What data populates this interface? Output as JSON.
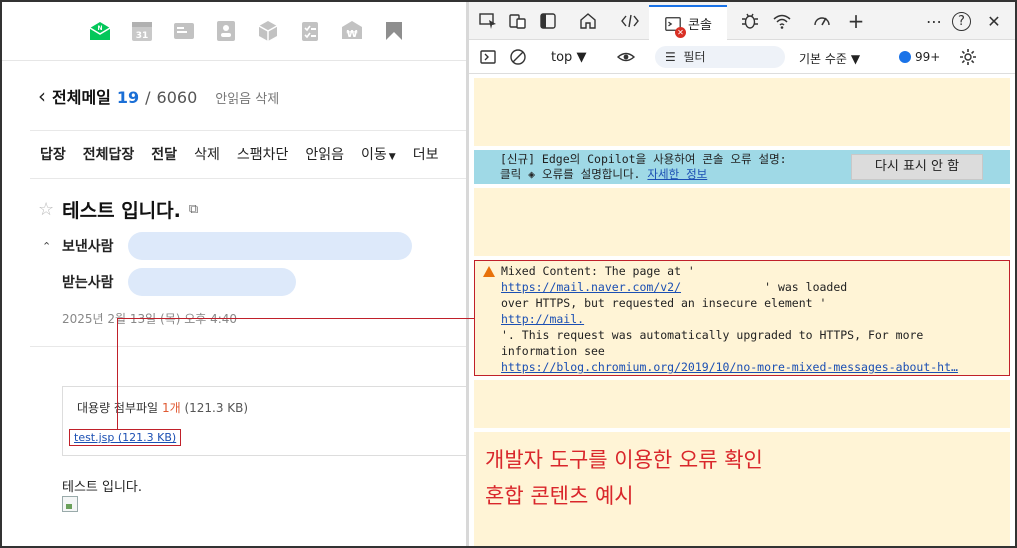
{
  "app_icons": [
    "naver-mail-icon",
    "calendar-icon",
    "contact-card-icon",
    "address-book-icon",
    "box-icon",
    "todo-icon",
    "pay-icon",
    "home-icon",
    "flag-icon"
  ],
  "calendar_number": "31",
  "mailbox": {
    "title": "전체메일",
    "unread": "19",
    "sep": "/",
    "total": "6060",
    "mark_read": "안읽음 삭제"
  },
  "mail_toolbar": {
    "reply": "답장",
    "reply_all": "전체답장",
    "forward": "전달",
    "delete": "삭제",
    "spam": "스팸차단",
    "unread": "안읽음",
    "move": "이동",
    "more": "더보"
  },
  "message": {
    "subject": "테스트 입니다.",
    "sender_label": "보낸사람",
    "receiver_label": "받는사람",
    "date": "2025년 2월 13일 (목) 오후 4:40",
    "attach_label": "대용량 첨부파일",
    "attach_count": "1개",
    "attach_size": "(121.3 KB)",
    "attach_file": "test.jsp (121.3 KB)",
    "body": "테스트 입니다."
  },
  "devtools": {
    "console_tab": "콘솔",
    "add_tab": "+",
    "more": "⋯",
    "help": "?",
    "close": "✕",
    "context": "top",
    "filter_placeholder": "필터",
    "level": "기본 수준",
    "issues_count": "99+",
    "copilot_line1": "[신규] Edge의 Copilot을 사용하여 콘솔 오류 설명:",
    "copilot_line2": "클릭",
    "copilot_line2b": "오류를 설명합니다.",
    "copilot_link": "자세한 정보",
    "dismiss": "다시 표시 안 함",
    "warn_line1": "Mixed Content: The page at '",
    "warn_url1": "https://mail.naver.com/v2/",
    "warn_line2b": "' was loaded",
    "warn_line3": "over HTTPS, but requested an insecure element '",
    "warn_url2": "http://mail.",
    "warn_line5": "'. This request was automatically upgraded to HTTPS, For more",
    "warn_line6": "information see",
    "warn_url3": "https://blog.chromium.org/2019/10/no-more-mixed-messages-about-ht…"
  },
  "annotation": {
    "line1": "개발자 도구를 이용한 오류 확인",
    "line2": "혼합 콘텐츠 예시"
  },
  "colors": {
    "accent": "#1a73e8",
    "annotation_red": "#d9262b",
    "warning_bg": "#fff4d6",
    "copilot_bg": "#9fd9e6",
    "unread_blue": "#1b6fd6"
  }
}
